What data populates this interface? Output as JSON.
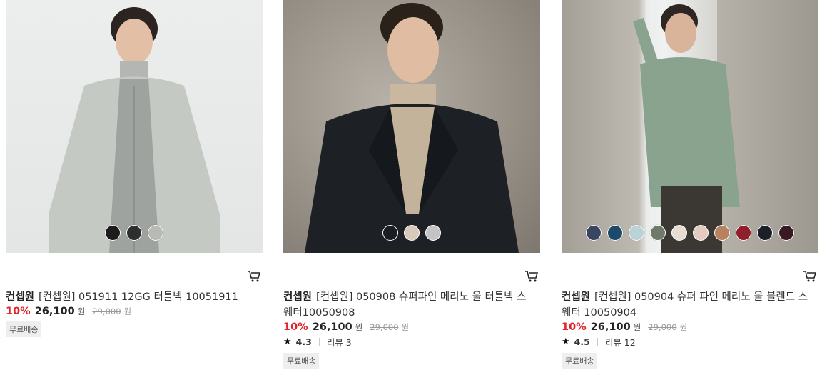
{
  "products": [
    {
      "brand": "컨셉원",
      "name": "[컨셉원] 051911 12GG 터틀넥 10051911",
      "discount": "10%",
      "price": "26,100",
      "currency": "원",
      "original_price": "29,000",
      "original_currency": "원",
      "badge": "무료배송",
      "swatches": [
        "#1c1c1c",
        "#2e2e2e",
        "#b8bab6"
      ]
    },
    {
      "brand": "컨셉원",
      "name": "[컨셉원] 050908 슈퍼파인 메리노 울 터틀넥 스웨터10050908",
      "discount": "10%",
      "price": "26,100",
      "currency": "원",
      "original_price": "29,000",
      "original_currency": "원",
      "rating": "4.3",
      "review_label": "리뷰 3",
      "badge": "무료배송",
      "swatches": [
        "#1a1d22",
        "#d9c9bd",
        "#c4c4c4"
      ]
    },
    {
      "brand": "컨셉원",
      "name": "[컨셉원] 050904 슈퍼 파인 메리노 울 블렌드 스웨터 10050904",
      "discount": "10%",
      "price": "26,100",
      "currency": "원",
      "original_price": "29,000",
      "original_currency": "원",
      "rating": "4.5",
      "review_label": "리뷰 12",
      "badge": "무료배송",
      "swatches": [
        "#3a4560",
        "#1d4a6b",
        "#b9d3d6",
        "#6f7a68",
        "#e7ddd5",
        "#e3cbc1",
        "#b8825e",
        "#8e1f2b",
        "#1c1f27",
        "#3a1a22"
      ]
    }
  ],
  "icons": {
    "cart": "cart-icon",
    "star": "star-icon"
  }
}
